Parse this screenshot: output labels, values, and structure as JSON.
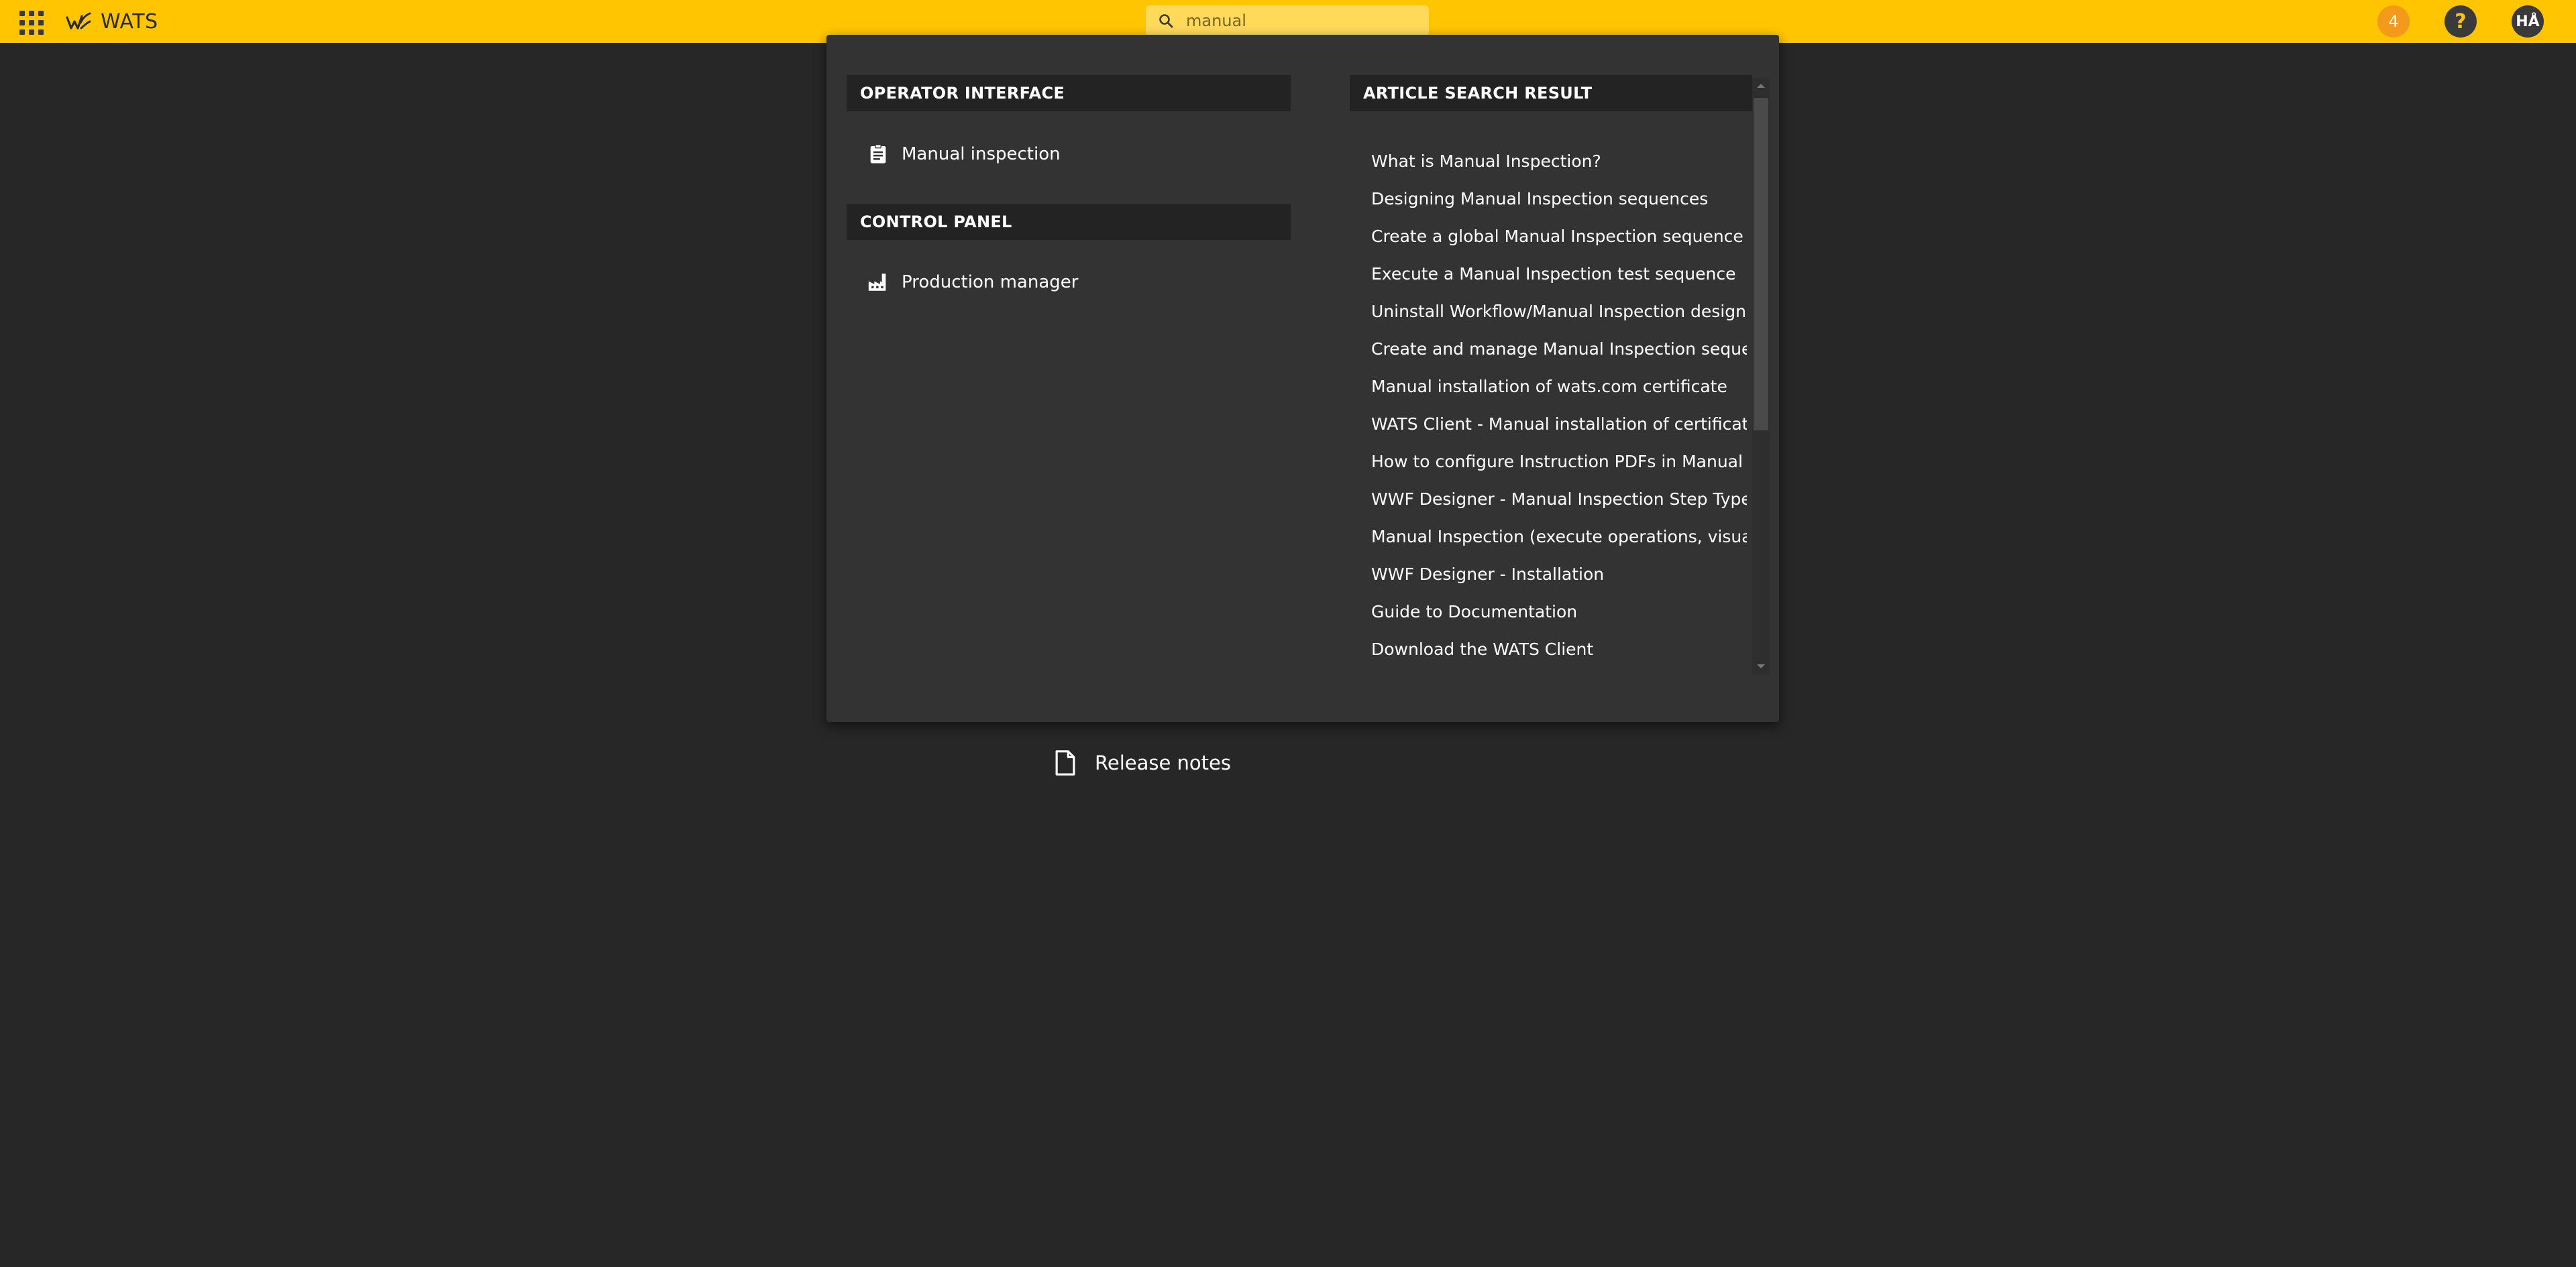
{
  "header": {
    "brand_name": "WATS",
    "search": {
      "value": "manual",
      "placeholder": ""
    },
    "notification_count": "4",
    "help_label": "?",
    "user_initials": "HÅ"
  },
  "search_results": {
    "operator_interface": {
      "heading": "OPERATOR INTERFACE",
      "items": [
        {
          "label": "Manual inspection",
          "icon": "clipboard-icon"
        }
      ]
    },
    "control_panel": {
      "heading": "CONTROL PANEL",
      "items": [
        {
          "label": "Production manager",
          "icon": "factory-icon"
        }
      ]
    },
    "articles": {
      "heading": "ARTICLE SEARCH RESULT",
      "items": [
        "What is Manual Inspection?",
        "Designing Manual Inspection sequences",
        "Create a global Manual Inspection sequence",
        "Execute a Manual Inspection test sequence",
        "Uninstall Workflow/Manual Inspection designer",
        "Create and manage Manual Inspection sequences",
        "Manual installation of wats.com certificate",
        "WATS Client - Manual installation of certificates",
        "How to configure Instruction PDFs in Manual inspe",
        "WWF Designer - Manual Inspection Step Types",
        "Manual Inspection (execute operations, visual insp",
        "WWF Designer - Installation",
        "Guide to Documentation",
        "Download the WATS Client"
      ]
    }
  },
  "release_notes": {
    "label": "Release notes",
    "icon": "document-icon"
  },
  "colors": {
    "topbar": "#ffc600",
    "background": "#272727",
    "panel": "#333333",
    "section_header": "#232323",
    "notification": "#f49a1a"
  }
}
